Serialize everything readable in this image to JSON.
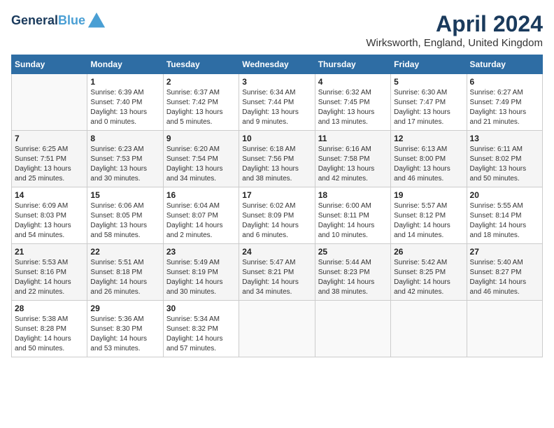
{
  "header": {
    "logo_line1": "General",
    "logo_line2": "Blue",
    "month_title": "April 2024",
    "location": "Wirksworth, England, United Kingdom"
  },
  "days_of_week": [
    "Sunday",
    "Monday",
    "Tuesday",
    "Wednesday",
    "Thursday",
    "Friday",
    "Saturday"
  ],
  "weeks": [
    [
      {
        "day": "",
        "sunrise": "",
        "sunset": "",
        "daylight": ""
      },
      {
        "day": "1",
        "sunrise": "Sunrise: 6:39 AM",
        "sunset": "Sunset: 7:40 PM",
        "daylight": "Daylight: 13 hours and 0 minutes."
      },
      {
        "day": "2",
        "sunrise": "Sunrise: 6:37 AM",
        "sunset": "Sunset: 7:42 PM",
        "daylight": "Daylight: 13 hours and 5 minutes."
      },
      {
        "day": "3",
        "sunrise": "Sunrise: 6:34 AM",
        "sunset": "Sunset: 7:44 PM",
        "daylight": "Daylight: 13 hours and 9 minutes."
      },
      {
        "day": "4",
        "sunrise": "Sunrise: 6:32 AM",
        "sunset": "Sunset: 7:45 PM",
        "daylight": "Daylight: 13 hours and 13 minutes."
      },
      {
        "day": "5",
        "sunrise": "Sunrise: 6:30 AM",
        "sunset": "Sunset: 7:47 PM",
        "daylight": "Daylight: 13 hours and 17 minutes."
      },
      {
        "day": "6",
        "sunrise": "Sunrise: 6:27 AM",
        "sunset": "Sunset: 7:49 PM",
        "daylight": "Daylight: 13 hours and 21 minutes."
      }
    ],
    [
      {
        "day": "7",
        "sunrise": "Sunrise: 6:25 AM",
        "sunset": "Sunset: 7:51 PM",
        "daylight": "Daylight: 13 hours and 25 minutes."
      },
      {
        "day": "8",
        "sunrise": "Sunrise: 6:23 AM",
        "sunset": "Sunset: 7:53 PM",
        "daylight": "Daylight: 13 hours and 30 minutes."
      },
      {
        "day": "9",
        "sunrise": "Sunrise: 6:20 AM",
        "sunset": "Sunset: 7:54 PM",
        "daylight": "Daylight: 13 hours and 34 minutes."
      },
      {
        "day": "10",
        "sunrise": "Sunrise: 6:18 AM",
        "sunset": "Sunset: 7:56 PM",
        "daylight": "Daylight: 13 hours and 38 minutes."
      },
      {
        "day": "11",
        "sunrise": "Sunrise: 6:16 AM",
        "sunset": "Sunset: 7:58 PM",
        "daylight": "Daylight: 13 hours and 42 minutes."
      },
      {
        "day": "12",
        "sunrise": "Sunrise: 6:13 AM",
        "sunset": "Sunset: 8:00 PM",
        "daylight": "Daylight: 13 hours and 46 minutes."
      },
      {
        "day": "13",
        "sunrise": "Sunrise: 6:11 AM",
        "sunset": "Sunset: 8:02 PM",
        "daylight": "Daylight: 13 hours and 50 minutes."
      }
    ],
    [
      {
        "day": "14",
        "sunrise": "Sunrise: 6:09 AM",
        "sunset": "Sunset: 8:03 PM",
        "daylight": "Daylight: 13 hours and 54 minutes."
      },
      {
        "day": "15",
        "sunrise": "Sunrise: 6:06 AM",
        "sunset": "Sunset: 8:05 PM",
        "daylight": "Daylight: 13 hours and 58 minutes."
      },
      {
        "day": "16",
        "sunrise": "Sunrise: 6:04 AM",
        "sunset": "Sunset: 8:07 PM",
        "daylight": "Daylight: 14 hours and 2 minutes."
      },
      {
        "day": "17",
        "sunrise": "Sunrise: 6:02 AM",
        "sunset": "Sunset: 8:09 PM",
        "daylight": "Daylight: 14 hours and 6 minutes."
      },
      {
        "day": "18",
        "sunrise": "Sunrise: 6:00 AM",
        "sunset": "Sunset: 8:11 PM",
        "daylight": "Daylight: 14 hours and 10 minutes."
      },
      {
        "day": "19",
        "sunrise": "Sunrise: 5:57 AM",
        "sunset": "Sunset: 8:12 PM",
        "daylight": "Daylight: 14 hours and 14 minutes."
      },
      {
        "day": "20",
        "sunrise": "Sunrise: 5:55 AM",
        "sunset": "Sunset: 8:14 PM",
        "daylight": "Daylight: 14 hours and 18 minutes."
      }
    ],
    [
      {
        "day": "21",
        "sunrise": "Sunrise: 5:53 AM",
        "sunset": "Sunset: 8:16 PM",
        "daylight": "Daylight: 14 hours and 22 minutes."
      },
      {
        "day": "22",
        "sunrise": "Sunrise: 5:51 AM",
        "sunset": "Sunset: 8:18 PM",
        "daylight": "Daylight: 14 hours and 26 minutes."
      },
      {
        "day": "23",
        "sunrise": "Sunrise: 5:49 AM",
        "sunset": "Sunset: 8:19 PM",
        "daylight": "Daylight: 14 hours and 30 minutes."
      },
      {
        "day": "24",
        "sunrise": "Sunrise: 5:47 AM",
        "sunset": "Sunset: 8:21 PM",
        "daylight": "Daylight: 14 hours and 34 minutes."
      },
      {
        "day": "25",
        "sunrise": "Sunrise: 5:44 AM",
        "sunset": "Sunset: 8:23 PM",
        "daylight": "Daylight: 14 hours and 38 minutes."
      },
      {
        "day": "26",
        "sunrise": "Sunrise: 5:42 AM",
        "sunset": "Sunset: 8:25 PM",
        "daylight": "Daylight: 14 hours and 42 minutes."
      },
      {
        "day": "27",
        "sunrise": "Sunrise: 5:40 AM",
        "sunset": "Sunset: 8:27 PM",
        "daylight": "Daylight: 14 hours and 46 minutes."
      }
    ],
    [
      {
        "day": "28",
        "sunrise": "Sunrise: 5:38 AM",
        "sunset": "Sunset: 8:28 PM",
        "daylight": "Daylight: 14 hours and 50 minutes."
      },
      {
        "day": "29",
        "sunrise": "Sunrise: 5:36 AM",
        "sunset": "Sunset: 8:30 PM",
        "daylight": "Daylight: 14 hours and 53 minutes."
      },
      {
        "day": "30",
        "sunrise": "Sunrise: 5:34 AM",
        "sunset": "Sunset: 8:32 PM",
        "daylight": "Daylight: 14 hours and 57 minutes."
      },
      {
        "day": "",
        "sunrise": "",
        "sunset": "",
        "daylight": ""
      },
      {
        "day": "",
        "sunrise": "",
        "sunset": "",
        "daylight": ""
      },
      {
        "day": "",
        "sunrise": "",
        "sunset": "",
        "daylight": ""
      },
      {
        "day": "",
        "sunrise": "",
        "sunset": "",
        "daylight": ""
      }
    ]
  ]
}
